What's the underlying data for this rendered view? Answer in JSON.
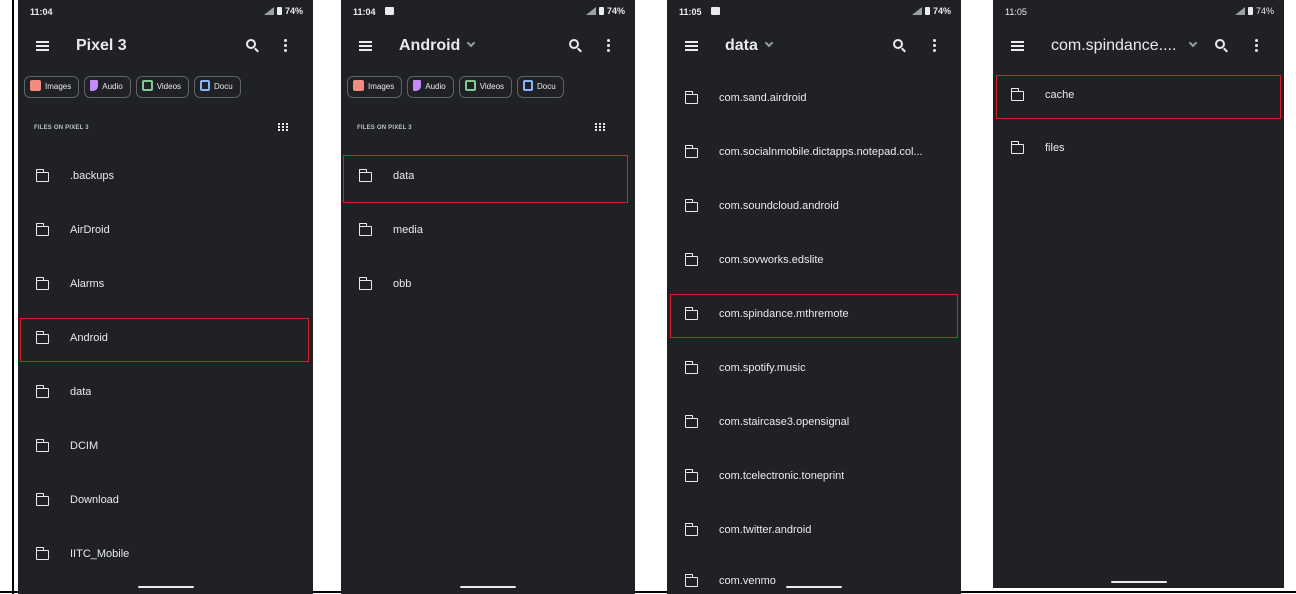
{
  "phones": [
    {
      "status_time": "11:04",
      "battery": "74%",
      "title": "Pixel 3",
      "chips": [
        {
          "icon": "images-icon",
          "label": "Images"
        },
        {
          "icon": "audio-icon",
          "label": "Audio"
        },
        {
          "icon": "videos-icon",
          "label": "Videos"
        },
        {
          "icon": "documents-icon",
          "label": "Docu"
        }
      ],
      "section_label": "FILES ON PIXEL 3",
      "items": [
        ".backups",
        "AirDroid",
        "Alarms",
        "Android",
        "data",
        "DCIM",
        "Download",
        "IITC_Mobile"
      ],
      "highlighted": "Android"
    },
    {
      "status_time": "11:04",
      "battery": "74%",
      "title": "Android",
      "chips": [
        {
          "icon": "images-icon",
          "label": "Images"
        },
        {
          "icon": "audio-icon",
          "label": "Audio"
        },
        {
          "icon": "videos-icon",
          "label": "Videos"
        },
        {
          "icon": "documents-icon",
          "label": "Docu"
        }
      ],
      "section_label": "FILES ON PIXEL 3",
      "items": [
        "data",
        "media",
        "obb"
      ],
      "highlighted": "data"
    },
    {
      "status_time": "11:05",
      "battery": "74%",
      "title": "data",
      "items": [
        "com.sand.airdroid",
        "com.socialnmobile.dictapps.notepad.col...",
        "com.soundcloud.android",
        "com.sovworks.edslite",
        "com.spindance.mthremote",
        "com.spotify.music",
        "com.staircase3.opensignal",
        "com.tcelectronic.toneprint",
        "com.twitter.android",
        "com.venmo"
      ],
      "highlighted": "com.spindance.mthremote"
    },
    {
      "status_time": "11:05",
      "battery": "74%",
      "title": "com.spindance....",
      "items": [
        "cache",
        "files"
      ],
      "highlighted": "cache"
    }
  ]
}
